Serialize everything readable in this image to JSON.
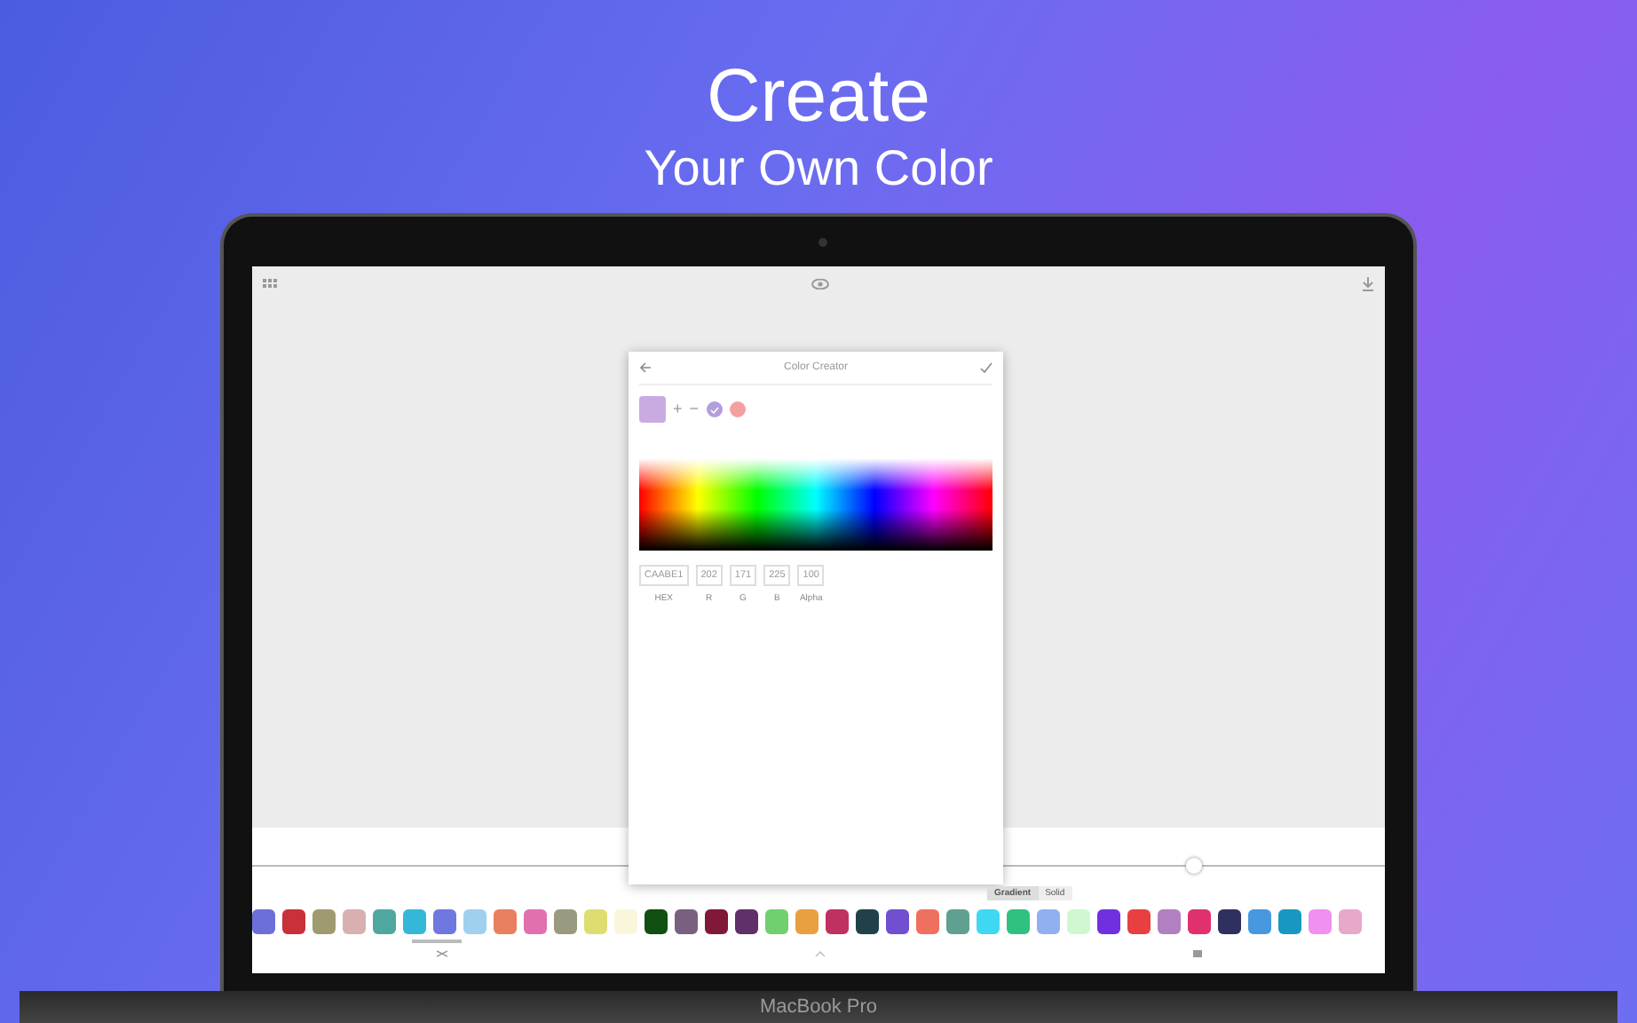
{
  "headline": {
    "title": "Create",
    "subtitle": "Your Own Color"
  },
  "laptop": {
    "brand": "MacBook Pro"
  },
  "dialog": {
    "title": "Color Creator",
    "preview": {
      "color": "#caabe1"
    },
    "add": "+",
    "remove": "−",
    "stops": [
      {
        "color": "#b39ddb",
        "selected": true
      },
      {
        "color": "#f4a0a0",
        "selected": false
      }
    ],
    "fields": [
      {
        "value": "CAABE1",
        "label": "HEX"
      },
      {
        "value": "202",
        "label": "R"
      },
      {
        "value": "171",
        "label": "G"
      },
      {
        "value": "225",
        "label": "B"
      },
      {
        "value": "100",
        "label": "Alpha"
      }
    ],
    "modes": [
      {
        "label": "Gradient",
        "selected": true
      },
      {
        "label": "Solid",
        "selected": false
      }
    ]
  },
  "slider": {
    "level": 0.83
  },
  "swatches": [
    {
      "color": "#6c6fd8"
    },
    {
      "color": "#c8303a"
    },
    {
      "color": "#a09a70"
    },
    {
      "color": "#d8b0b0"
    },
    {
      "color": "#4fa8a0"
    },
    {
      "color": "#35b8d8"
    },
    {
      "color": "#6f78e0"
    },
    {
      "color": "#9fd0ef"
    },
    {
      "color": "#e88060"
    },
    {
      "color": "#e070b0"
    },
    {
      "color": "#9a9a80"
    },
    {
      "color": "#dede70"
    },
    {
      "color": "#faf6dc"
    },
    {
      "color": "#105010"
    },
    {
      "color": "#7a6080"
    },
    {
      "color": "#801838"
    },
    {
      "color": "#603068"
    },
    {
      "color": "#70d070"
    },
    {
      "color": "#e8a040"
    },
    {
      "color": "#c03060"
    },
    {
      "color": "#20404a"
    },
    {
      "color": "#7050d0"
    },
    {
      "color": "#f07060"
    },
    {
      "color": "#60a090"
    },
    {
      "color": "#40d8f0"
    },
    {
      "color": "#30c080"
    },
    {
      "color": "#90b0f0"
    },
    {
      "color": "#d0f8d0"
    },
    {
      "color": "#7030e0"
    },
    {
      "color": "#e84040"
    },
    {
      "color": "#b080c0"
    },
    {
      "color": "#e03070"
    },
    {
      "color": "#303060"
    },
    {
      "color": "#4898e0"
    },
    {
      "color": "#1898c0"
    },
    {
      "color": "#f090f0"
    },
    {
      "color": "#e8a8c8"
    }
  ]
}
